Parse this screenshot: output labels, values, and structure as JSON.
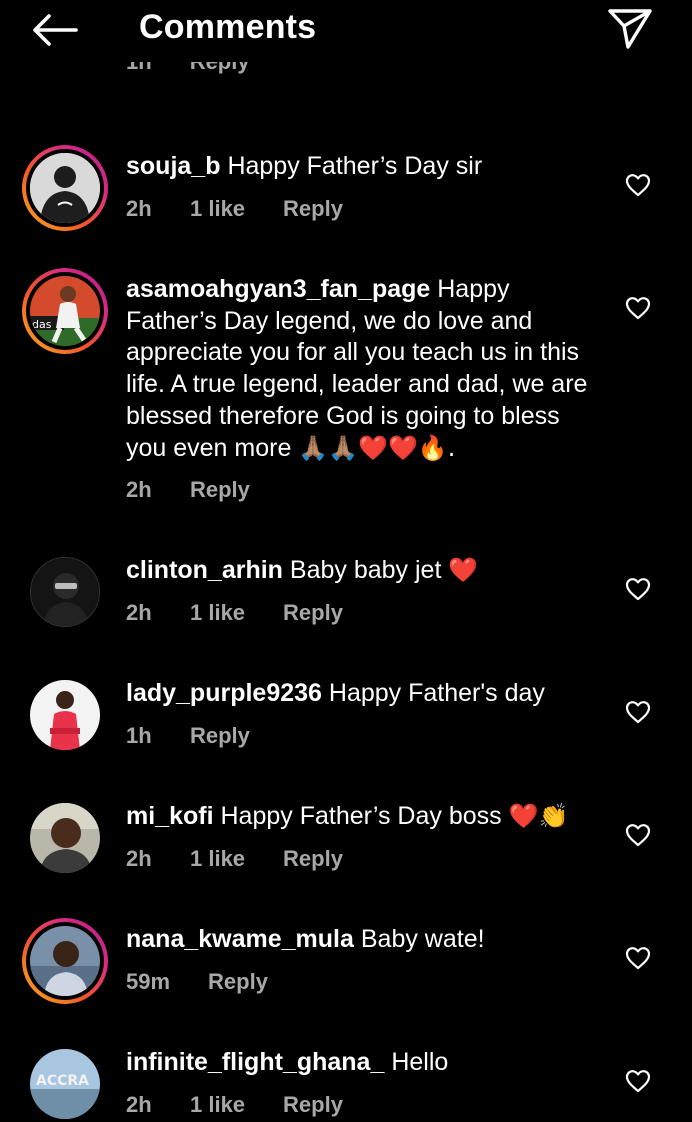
{
  "header": {
    "title": "Comments",
    "back_icon": "arrow-left-icon",
    "share_icon": "paper-plane-icon"
  },
  "partial_top": {
    "time": "1h",
    "reply": "Reply"
  },
  "comments": [
    {
      "username": "souja_b",
      "text": "Happy Father’s Day sir",
      "emojis": "",
      "time": "2h",
      "likes": "1 like",
      "reply": "Reply",
      "story_ring": true
    },
    {
      "username": "asamoahgyan3_fan_page",
      "text": "Happy Father’s Day legend, we do love and appreciate you for all you teach us in this life. A true legend, leader and dad, we are blessed therefore God is going to bless you even more",
      "emojis": "🙏🏽🙏🏽❤️❤️🔥.",
      "time": "2h",
      "likes": "",
      "reply": "Reply",
      "story_ring": true
    },
    {
      "username": "clinton_arhin",
      "text": "Baby baby jet",
      "emojis": "❤️",
      "time": "2h",
      "likes": "1 like",
      "reply": "Reply",
      "story_ring": false
    },
    {
      "username": "lady_purple9236",
      "text": "Happy Father's day",
      "emojis": "",
      "time": "1h",
      "likes": "",
      "reply": "Reply",
      "story_ring": false
    },
    {
      "username": "mi_kofi",
      "text": "Happy Father’s Day boss",
      "emojis": "❤️👏",
      "time": "2h",
      "likes": "1 like",
      "reply": "Reply",
      "story_ring": false
    },
    {
      "username": "nana_kwame_mula",
      "text": "Baby wate!",
      "emojis": "",
      "time": "59m",
      "likes": "",
      "reply": "Reply",
      "story_ring": true
    },
    {
      "username": "infinite_flight_ghana_",
      "text": "Hello",
      "emojis": "",
      "time": "2h",
      "likes": "1 like",
      "reply": "Reply",
      "story_ring": false
    }
  ],
  "avatar_texts": {
    "accra": "ACCRA",
    "adidas": "das"
  },
  "icons": {
    "like": "heart-outline-icon"
  },
  "colors": {
    "background": "#000000",
    "text": "#ffffff",
    "meta": "#a8a8a8",
    "ring_start": "#f9b11d",
    "ring_end": "#b4198f"
  }
}
